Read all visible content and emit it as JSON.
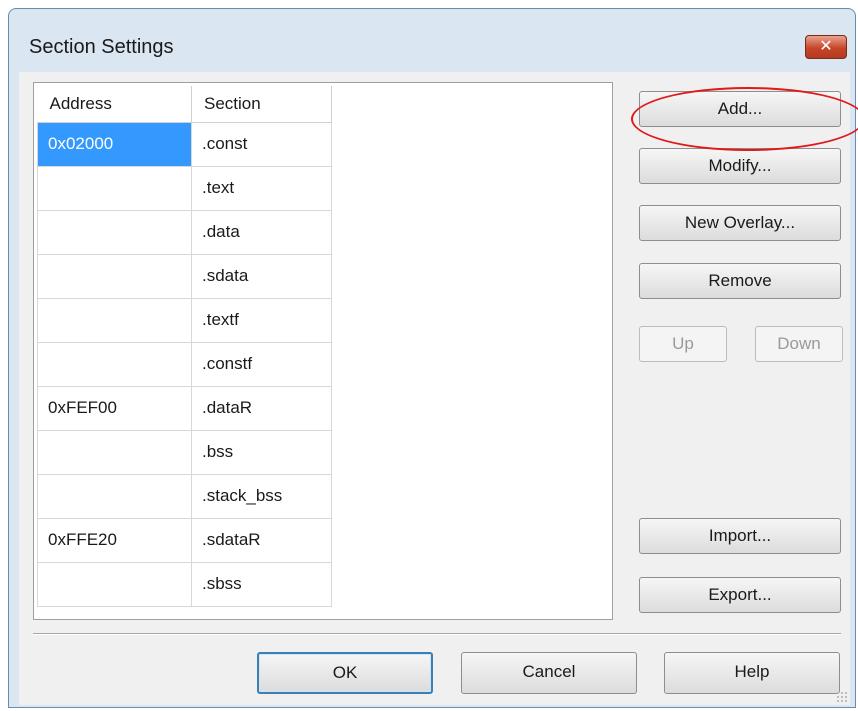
{
  "window": {
    "title": "Section Settings",
    "close_label": "✕"
  },
  "table": {
    "headers": [
      "Address",
      "Section"
    ],
    "rows": [
      {
        "address": "0x02000",
        "section": ".const"
      },
      {
        "address": "",
        "section": ".text"
      },
      {
        "address": "",
        "section": ".data"
      },
      {
        "address": "",
        "section": ".sdata"
      },
      {
        "address": "",
        "section": ".textf"
      },
      {
        "address": "",
        "section": ".constf"
      },
      {
        "address": "0xFEF00",
        "section": ".dataR"
      },
      {
        "address": "",
        "section": ".bss"
      },
      {
        "address": "",
        "section": ".stack_bss"
      },
      {
        "address": "0xFFE20",
        "section": ".sdataR"
      },
      {
        "address": "",
        "section": ".sbss"
      }
    ],
    "selected_row": 0
  },
  "side_buttons": {
    "add": "Add...",
    "modify": "Modify...",
    "new_overlay": "New Overlay...",
    "remove": "Remove",
    "up": "Up",
    "down": "Down",
    "import": "Import...",
    "export": "Export..."
  },
  "bottom_buttons": {
    "ok": "OK",
    "cancel": "Cancel",
    "help": "Help"
  },
  "colors": {
    "selection": "#3399ff",
    "annotation": "#e01a1a",
    "title_bar": "#dbe6f3"
  }
}
